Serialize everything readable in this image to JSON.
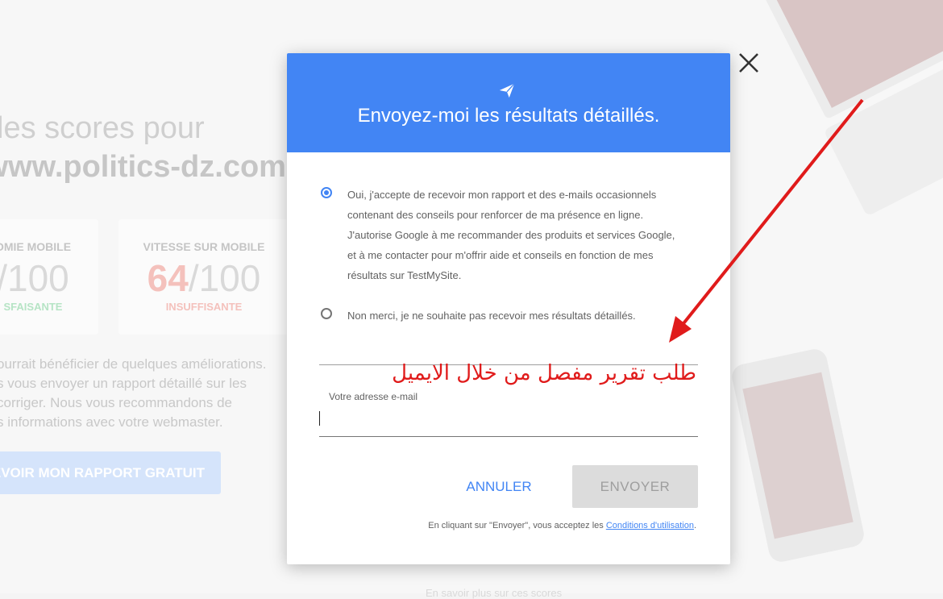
{
  "background": {
    "heading_line1": "les scores pour",
    "heading_line2": "/www.politics-dz.com",
    "cards": [
      {
        "label": "OMIE MOBILE",
        "score_prefix": "",
        "score_suffix": "/100",
        "status": "SFAISANTE"
      },
      {
        "label": "VITESSE SUR MOBILE",
        "score_prefix": "64",
        "score_suffix": "/100",
        "status": "INSUFFISANTE"
      }
    ],
    "paragraph_lines": [
      "ourrait bénéficier de quelques améliorations.",
      "s vous envoyer un rapport détaillé sur les",
      "corriger. Nous vous recommandons de",
      "s informations avec votre webmaster."
    ],
    "cta_label": "EVOIR MON RAPPORT GRATUIT",
    "footer_text": "En savoir plus sur ces scores"
  },
  "dialog": {
    "title": "Envoyez-moi les résultats détaillés.",
    "icons": {
      "header": "send-icon",
      "close": "close-icon"
    },
    "accent_color": "#4285f4",
    "options": [
      {
        "checked": true,
        "lines": [
          "Oui, j'accepte de recevoir mon rapport et des e-mails occasionnels",
          "contenant des conseils pour renforcer de ma présence en ligne.",
          "J'autorise Google à me recommander des produits et services Google,",
          "et à me contacter pour m'offrir aide et conseils en fonction de mes",
          "résultats sur TestMySite."
        ]
      },
      {
        "checked": false,
        "lines": [
          "Non merci, je ne souhaite pas recevoir mes résultats détaillés."
        ]
      }
    ],
    "annotation_text": "طلب تقرير مفصل من خلال الايميل",
    "annotation_color": "#e01b1b",
    "email": {
      "label": "Votre adresse e-mail",
      "value": ""
    },
    "cancel_label": "ANNULER",
    "send_label": "ENVOYER",
    "terms_prefix": "En cliquant sur \"Envoyer\", vous acceptez les ",
    "terms_link": "Conditions d'utilisation",
    "terms_suffix": "."
  }
}
